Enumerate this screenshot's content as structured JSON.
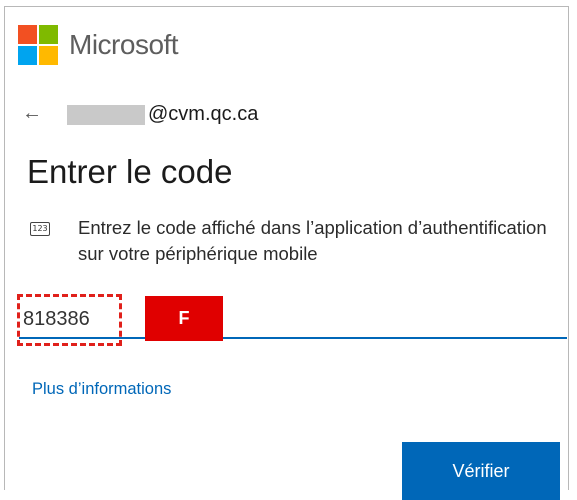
{
  "brand": {
    "name": "Microsoft",
    "logo_colors": [
      "#f25022",
      "#7fba00",
      "#00a4ef",
      "#ffb900"
    ]
  },
  "account": {
    "back_icon": "arrow-left-icon",
    "email_domain": "@cvm.qc.ca"
  },
  "page_title": "Entrer le code",
  "instruction": {
    "icon": "keypad-icon",
    "icon_text": "123",
    "text": "Entrez le code affiché dans l’application d’authentification sur votre périphérique mobile"
  },
  "code_field": {
    "value": "818386",
    "underline_color": "#0067b8"
  },
  "annotation": {
    "label": "F",
    "color": "#e00000"
  },
  "more_info_link": "Plus d’informations",
  "verify_button": {
    "label": "Vérifier",
    "color": "#0067b8"
  }
}
